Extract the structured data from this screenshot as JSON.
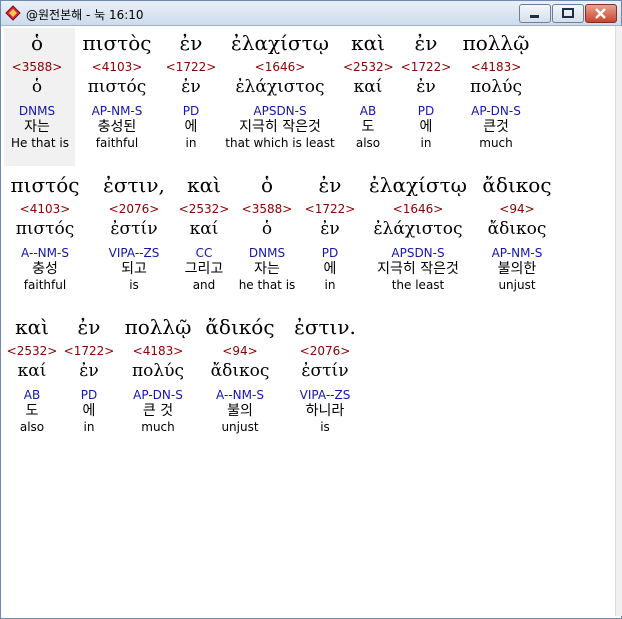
{
  "window": {
    "title": "@원전본해 - 눅 16:10",
    "controls": {
      "minimize": "minimize",
      "maximize": "maximize",
      "close": "close"
    }
  },
  "verse": {
    "lines": [
      {
        "words": [
          {
            "greek": "ὁ",
            "strong": "<3588>",
            "lexeme": "ὁ",
            "parse": "DNMS",
            "korean": "자는",
            "english": "He that is"
          },
          {
            "greek": "πιστὸς",
            "strong": "<4103>",
            "lexeme": "πιστός",
            "parse": "AP-NM-S",
            "korean": "충성된",
            "english": "faithful"
          },
          {
            "greek": "ἐν",
            "strong": "<1722>",
            "lexeme": "ἐν",
            "parse": "PD",
            "korean": "에",
            "english": "in"
          },
          {
            "greek": "ἐλαχίστῳ",
            "strong": "<1646>",
            "lexeme": "ἐλάχιστος",
            "parse": "APSDN-S",
            "korean": "지극히 작은것",
            "english": "that which is least"
          },
          {
            "greek": "καὶ",
            "strong": "<2532>",
            "lexeme": "καί",
            "parse": "AB",
            "korean": "도",
            "english": "also"
          },
          {
            "greek": "ἐν",
            "strong": "<1722>",
            "lexeme": "ἐν",
            "parse": "PD",
            "korean": "에",
            "english": "in"
          },
          {
            "greek": "πολλῷ",
            "strong": "<4183>",
            "lexeme": "πολύς",
            "parse": "AP-DN-S",
            "korean": "큰것",
            "english": "much"
          }
        ]
      },
      {
        "words": [
          {
            "greek": "πιστός",
            "strong": "<4103>",
            "lexeme": "πιστός",
            "parse": "A--NM-S",
            "korean": "충성",
            "english": "faithful"
          },
          {
            "greek": "ἐστιν,",
            "strong": "<2076>",
            "lexeme": "ἐστίν",
            "parse": "VIPA--ZS",
            "korean": "되고",
            "english": "is"
          },
          {
            "greek": "καὶ",
            "strong": "<2532>",
            "lexeme": "καί",
            "parse": "CC",
            "korean": "그리고",
            "english": "and"
          },
          {
            "greek": "ὁ",
            "strong": "<3588>",
            "lexeme": "ὁ",
            "parse": "DNMS",
            "korean": "자는",
            "english": "he that is"
          },
          {
            "greek": "ἐν",
            "strong": "<1722>",
            "lexeme": "ἐν",
            "parse": "PD",
            "korean": "에",
            "english": "in"
          },
          {
            "greek": "ἐλαχίστῳ",
            "strong": "<1646>",
            "lexeme": "ἐλάχιστος",
            "parse": "APSDN-S",
            "korean": "지극히 작은것",
            "english": "the least"
          },
          {
            "greek": "ἄδικος",
            "strong": "<94>",
            "lexeme": "ἄδικος",
            "parse": "AP-NM-S",
            "korean": "불의한",
            "english": "unjust"
          }
        ]
      },
      {
        "words": [
          {
            "greek": "καὶ",
            "strong": "<2532>",
            "lexeme": "καί",
            "parse": "AB",
            "korean": "도",
            "english": "also"
          },
          {
            "greek": "ἐν",
            "strong": "<1722>",
            "lexeme": "ἐν",
            "parse": "PD",
            "korean": "에",
            "english": "in"
          },
          {
            "greek": "πολλῷ",
            "strong": "<4183>",
            "lexeme": "πολύς",
            "parse": "AP-DN-S",
            "korean": "큰 것",
            "english": "much"
          },
          {
            "greek": "ἄδικός",
            "strong": "<94>",
            "lexeme": "ἄδικος",
            "parse": "A--NM-S",
            "korean": "불의",
            "english": "unjust"
          },
          {
            "greek": "ἐστιν.",
            "strong": "<2076>",
            "lexeme": "ἐστίν",
            "parse": "VIPA--ZS",
            "korean": "하니라",
            "english": "is"
          }
        ]
      }
    ]
  },
  "colors": {
    "strong_number": "#8b0000",
    "parsing": "#1515b0",
    "text": "#000000",
    "title_bar": "#cddbeb"
  }
}
